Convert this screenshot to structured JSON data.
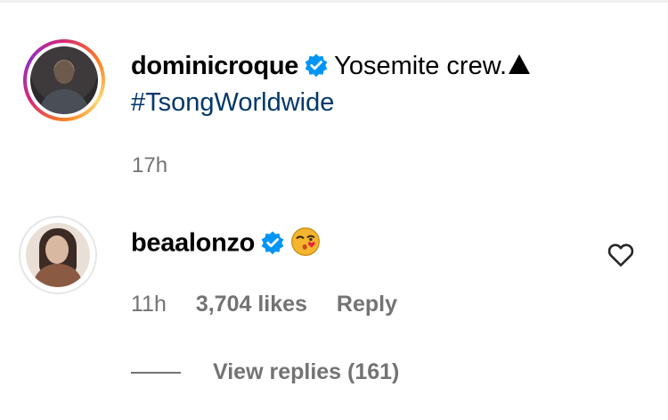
{
  "post": {
    "username": "dominicroque",
    "caption": "Yosemite crew.",
    "hashtag": "#TsongWorldwide",
    "time": "17h"
  },
  "comment": {
    "username": "beaalonzo",
    "emoji": "face-blowing-a-kiss",
    "time": "11h",
    "likes": "3,704 likes",
    "reply_label": "Reply",
    "view_replies_label": "View replies (161)"
  },
  "colors": {
    "verified": "#0095f6",
    "hashtag": "#00376b",
    "muted": "#737373"
  },
  "icons": {
    "verified": "verified-badge-icon",
    "heart": "heart-outline-icon",
    "triangle": "triangle-icon"
  }
}
